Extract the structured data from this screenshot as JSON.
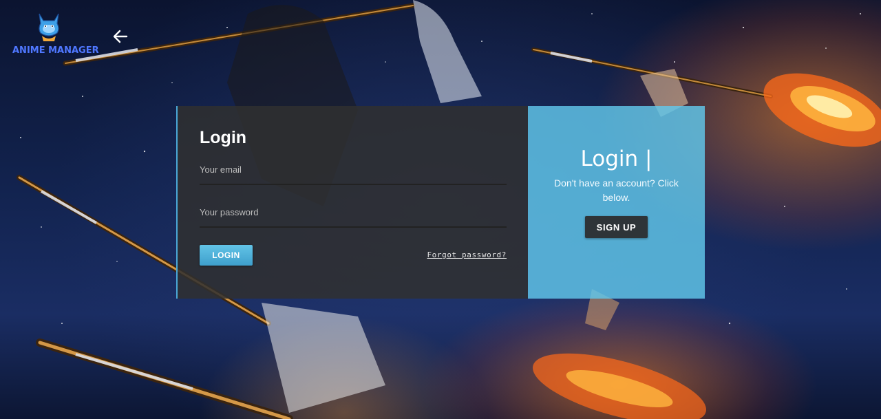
{
  "app": {
    "logo_text": "ANIME MANAGER",
    "logo_icon": "cat-mascot-icon",
    "back_icon": "arrow-left-icon"
  },
  "login": {
    "title": "Login",
    "email_placeholder": "Your email",
    "password_placeholder": "Your password",
    "login_button": "LOGIN",
    "forgot_link": "Forgot password?"
  },
  "signup_panel": {
    "title": "Login |",
    "caption": "Don't have an account? Click below.",
    "signup_button": "SIGN UP"
  },
  "colors": {
    "accent": "#4aa8d8",
    "panel_right": "#62c8eb",
    "panel_left": "#303030",
    "logo_text": "#4f78ff",
    "signup_button": "#2e3438"
  }
}
